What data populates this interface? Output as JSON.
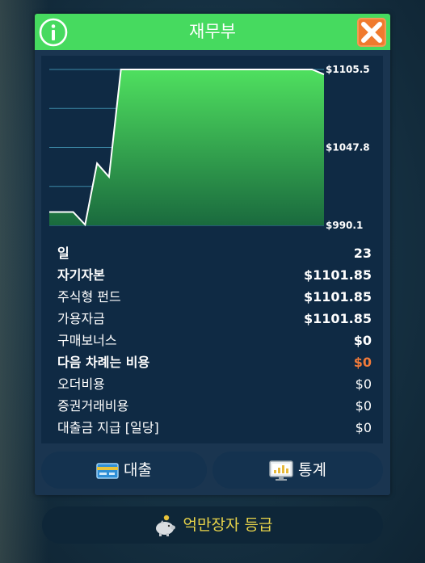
{
  "window": {
    "title": "재무부"
  },
  "chart_data": {
    "type": "area",
    "y_ticks": [
      "$1105.5",
      "$1047.8",
      "$990.1"
    ],
    "ylim": [
      990.1,
      1105.5
    ],
    "x": [
      0,
      1,
      2,
      3,
      4,
      5,
      6,
      7,
      8,
      9,
      10,
      11,
      12,
      13,
      14,
      15,
      16,
      17,
      18,
      19,
      20,
      21,
      22,
      23
    ],
    "values": [
      1000,
      1000,
      1000,
      990.6,
      1036,
      1026,
      1105.5,
      1105.5,
      1105.5,
      1105.5,
      1105.5,
      1105.5,
      1105.5,
      1105.5,
      1105.5,
      1105.5,
      1105.5,
      1105.5,
      1105.5,
      1105.5,
      1105.5,
      1105.5,
      1105.5,
      1101.85
    ],
    "colors": {
      "fill_top": "#4fe05f",
      "fill_bottom": "#1a6a3e",
      "line": "#ffffff",
      "grid": "#3d8aa8"
    }
  },
  "stats": [
    {
      "label": "일",
      "value": "23"
    },
    {
      "label": "자기자본",
      "value": "$1101.85"
    },
    {
      "label": "주식형 펀드",
      "value": "$1101.85"
    },
    {
      "label": "가용자금",
      "value": "$1101.85"
    },
    {
      "label": "구매보너스",
      "value": "$0"
    },
    {
      "label": "다음 차례는 비용",
      "value": "$0"
    },
    {
      "label": "오더비용",
      "value": "$0"
    },
    {
      "label": "증권거래비용",
      "value": "$0"
    },
    {
      "label": "대출금 지급 [일당]",
      "value": "$0"
    }
  ],
  "buttons": {
    "loan": "대출",
    "stats": "통계",
    "rank": "억만장자 등급"
  },
  "icons": {
    "info": "info-icon",
    "close": "close-icon",
    "loan": "card-icon",
    "stats": "monitor-chart-icon",
    "rank": "piggy-bank-icon"
  }
}
